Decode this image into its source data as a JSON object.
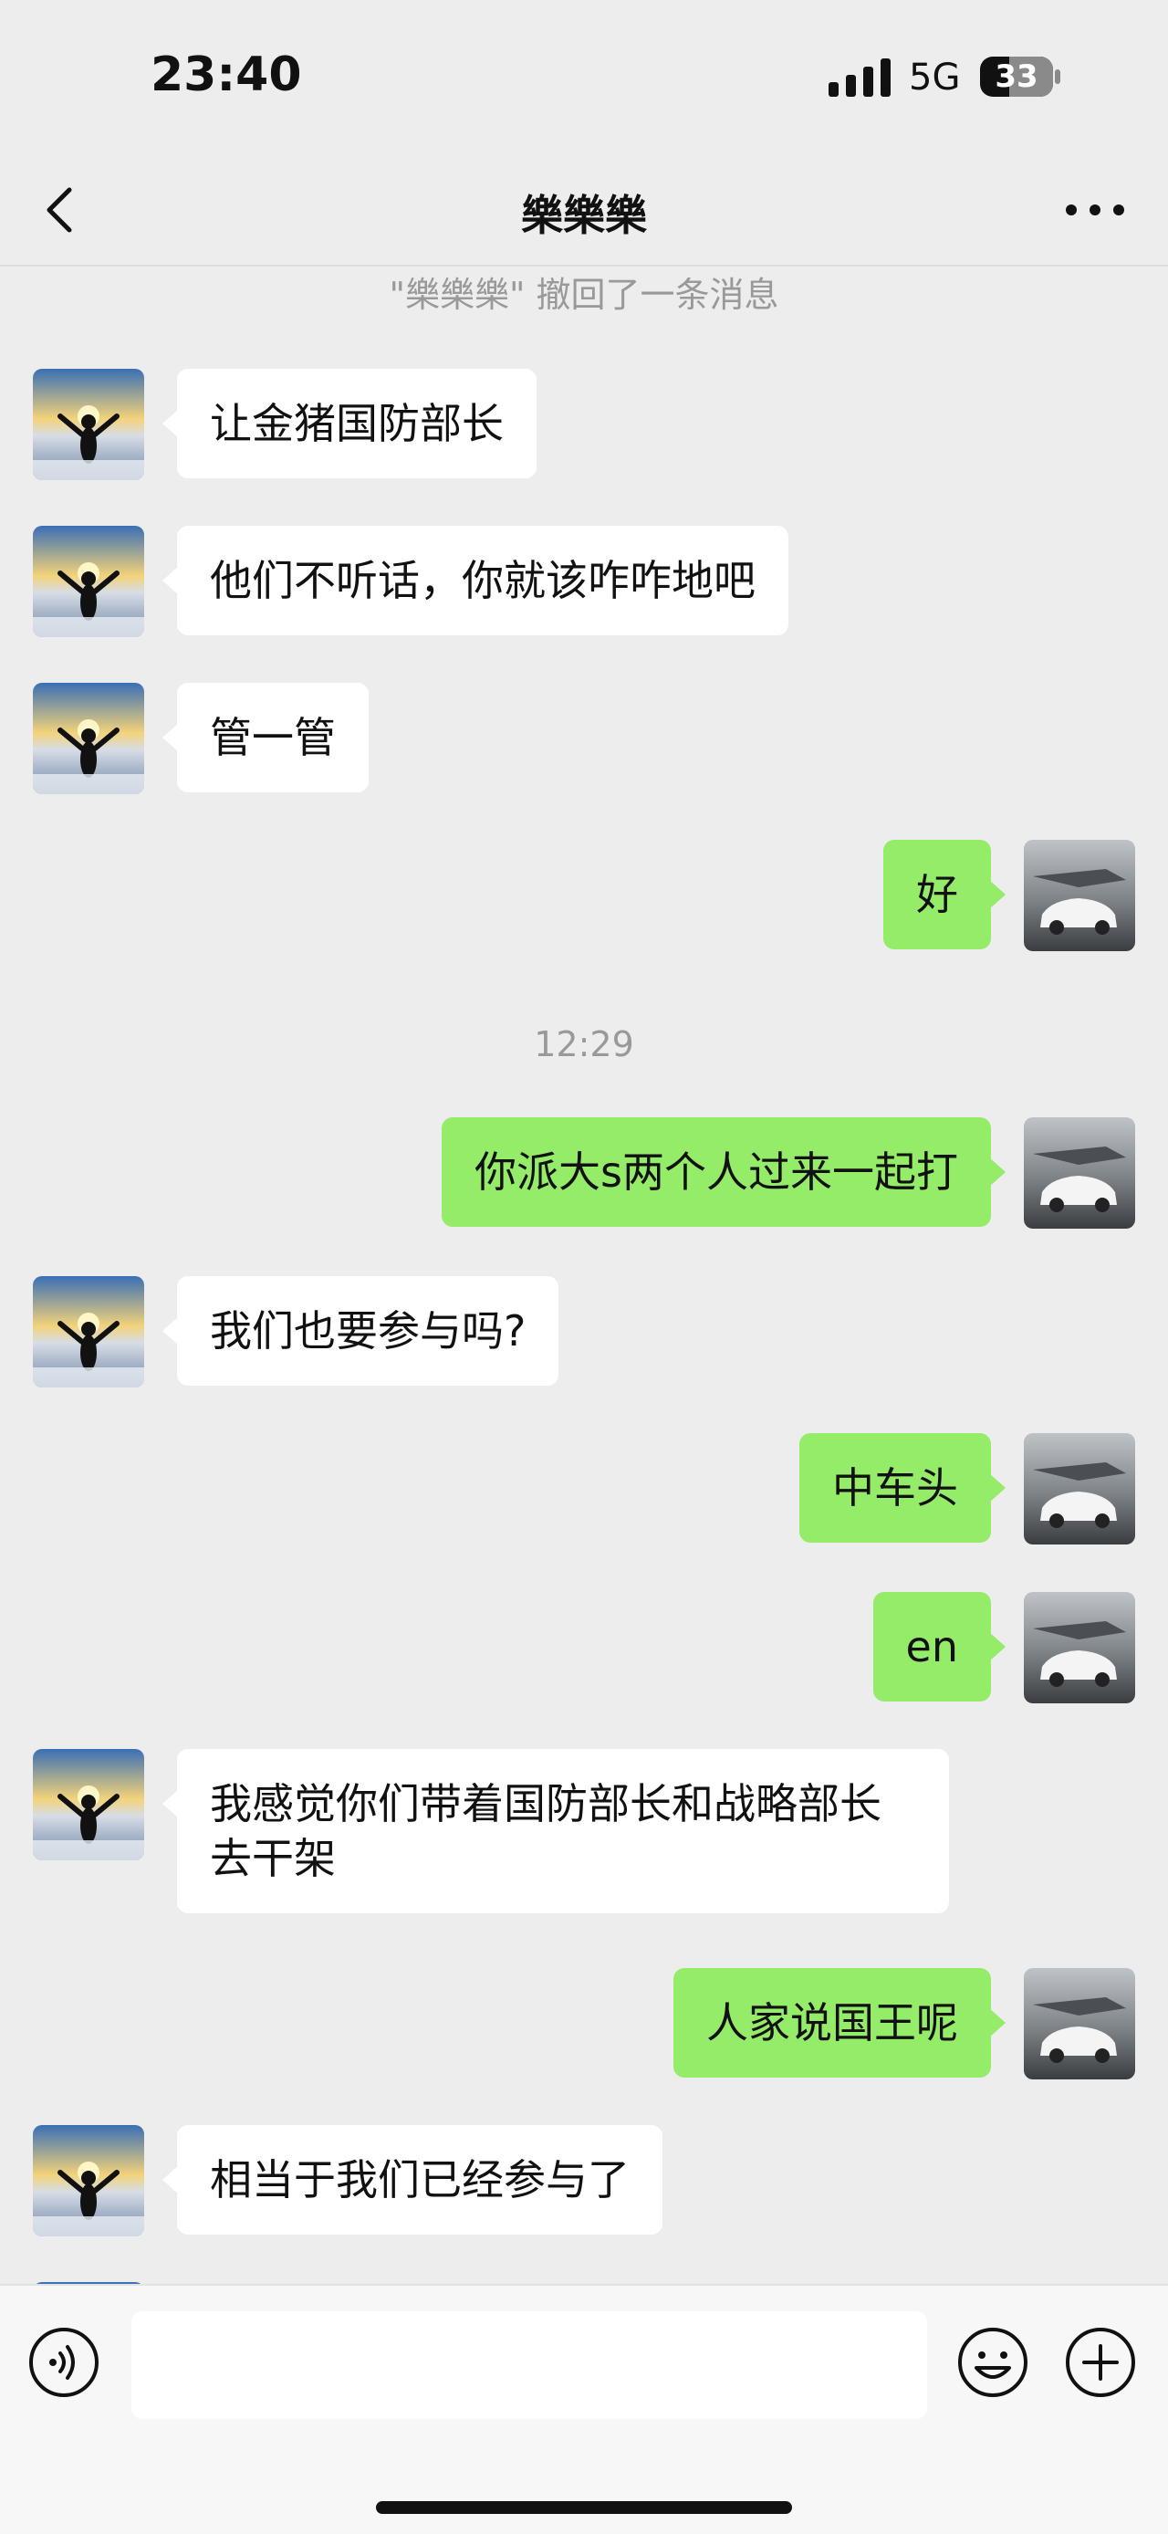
{
  "status": {
    "time": "23:40",
    "network": "5G",
    "battery": "33"
  },
  "header": {
    "title": "樂樂樂"
  },
  "chat": {
    "recall_notice": "\"樂樂樂\" 撤回了一条消息",
    "timestamp": "12:29",
    "messages": [
      {
        "dir": "in",
        "text": "让金猪国防部长"
      },
      {
        "dir": "in",
        "text": "他们不听话，你就该咋咋地吧"
      },
      {
        "dir": "in",
        "text": "管一管"
      },
      {
        "dir": "out",
        "text": "好"
      },
      {
        "dir": "out",
        "text": "你派大s两个人过来一起打"
      },
      {
        "dir": "in",
        "text": "我们也要参与吗?"
      },
      {
        "dir": "out",
        "text": "中车头"
      },
      {
        "dir": "out",
        "text": "en"
      },
      {
        "dir": "in",
        "text": "我感觉你们带着国防部长和战略部长去干架"
      },
      {
        "dir": "out",
        "text": "人家说国王呢"
      },
      {
        "dir": "in",
        "text": "相当于我们已经参与了"
      }
    ]
  },
  "icons": {
    "back": "chevron-left-icon",
    "more": "more-dots-icon",
    "voice": "voice-icon",
    "emoji": "emoji-icon",
    "plus": "plus-icon"
  },
  "colors": {
    "bubble_out": "#95ec69",
    "bubble_in": "#ffffff",
    "background": "#ededed"
  }
}
